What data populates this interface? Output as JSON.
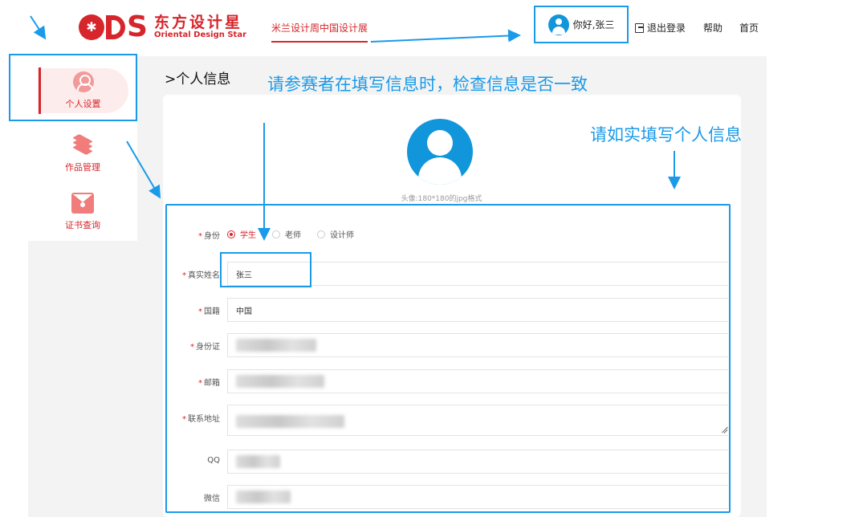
{
  "header": {
    "brand_cn": "东方设计星",
    "brand_en": "Oriental Design Star",
    "top_link": "米兰设计周中国设计展",
    "user_greeting": "你好,张三",
    "logout": "退出登录",
    "help": "帮助",
    "home": "首页"
  },
  "sidebar": {
    "items": [
      {
        "label": "个人设置",
        "icon": "person-icon"
      },
      {
        "label": "作品管理",
        "icon": "layers-icon"
      },
      {
        "label": "证书查询",
        "icon": "envelope-icon"
      }
    ]
  },
  "main": {
    "page_title": ">个人信息",
    "avatar_hint": "头像:180*180的jpg格式"
  },
  "form": {
    "identity": {
      "label": "身份",
      "options": [
        "学生",
        "老师",
        "设计师"
      ],
      "selected": "学生"
    },
    "real_name": {
      "label": "真实姓名",
      "value": "张三"
    },
    "nationality": {
      "label": "国籍",
      "value": "中国"
    },
    "id_card": {
      "label": "身份证",
      "value": ""
    },
    "email": {
      "label": "邮箱",
      "value": ""
    },
    "address": {
      "label": "联系地址",
      "value": ""
    },
    "qq": {
      "label": "QQ",
      "value": ""
    },
    "wechat": {
      "label": "微信",
      "value": ""
    }
  },
  "annotations": {
    "check_note": "请参赛者在填写信息时，检查信息是否一致",
    "truthful_note": "请如实填写个人信息"
  },
  "colors": {
    "brand_red": "#d6252b",
    "annotation_blue": "#1a9ae8",
    "avatar_blue": "#1296db"
  }
}
